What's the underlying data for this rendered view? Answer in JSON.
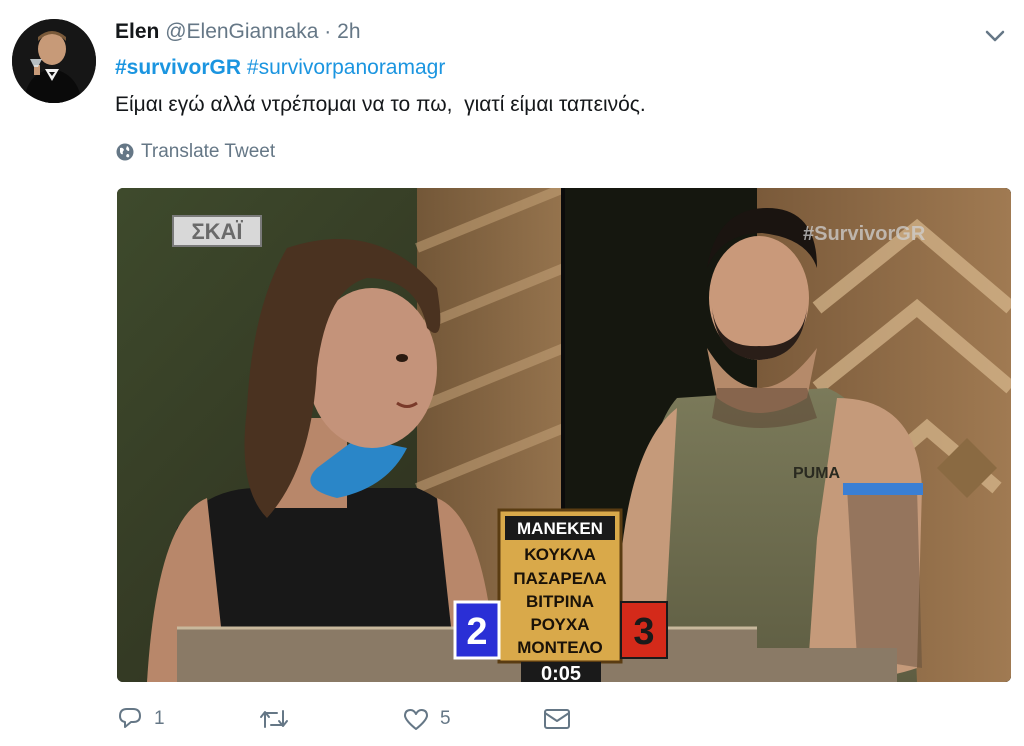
{
  "tweet": {
    "author_name": "Elen",
    "author_handle": "@ElenGiannaka",
    "separator": "·",
    "time": "2h",
    "hashtags": [
      "#survivorGR",
      "#survivorpanoramagr"
    ],
    "text": "Είμαι εγώ αλλά ντρέπομαι να το πω,  γιατί είμαι ταπεινός.",
    "translate_label": "Translate Tweet"
  },
  "media": {
    "channel_logo": "ΣΚΑΪ",
    "watermark": "#SurvivorGR",
    "shirt_logo": "PUMA",
    "board_words": [
      "ΜΑΝΕΚΕΝ",
      "ΚΟΥΚΛΑ",
      "ΠΑΣΑΡΕΛΑ",
      "ΒΙΤΡΙΝΑ",
      "ΡΟΥΧΑ",
      "ΜΟΝΤΕΛΟ"
    ],
    "score_blue": "2",
    "score_red": "3",
    "timer": "0:05",
    "colors": {
      "blue_team": "#2a2fd6",
      "red_team": "#d42a1a",
      "board": "#d9a94a"
    }
  },
  "actions": {
    "reply_count": "1",
    "retweet_count": "",
    "like_count": "5",
    "icons": [
      "reply-icon",
      "retweet-icon",
      "like-icon",
      "dm-icon"
    ]
  },
  "colors": {
    "link": "#1b95e0",
    "muted": "#657786",
    "text": "#14171a"
  }
}
